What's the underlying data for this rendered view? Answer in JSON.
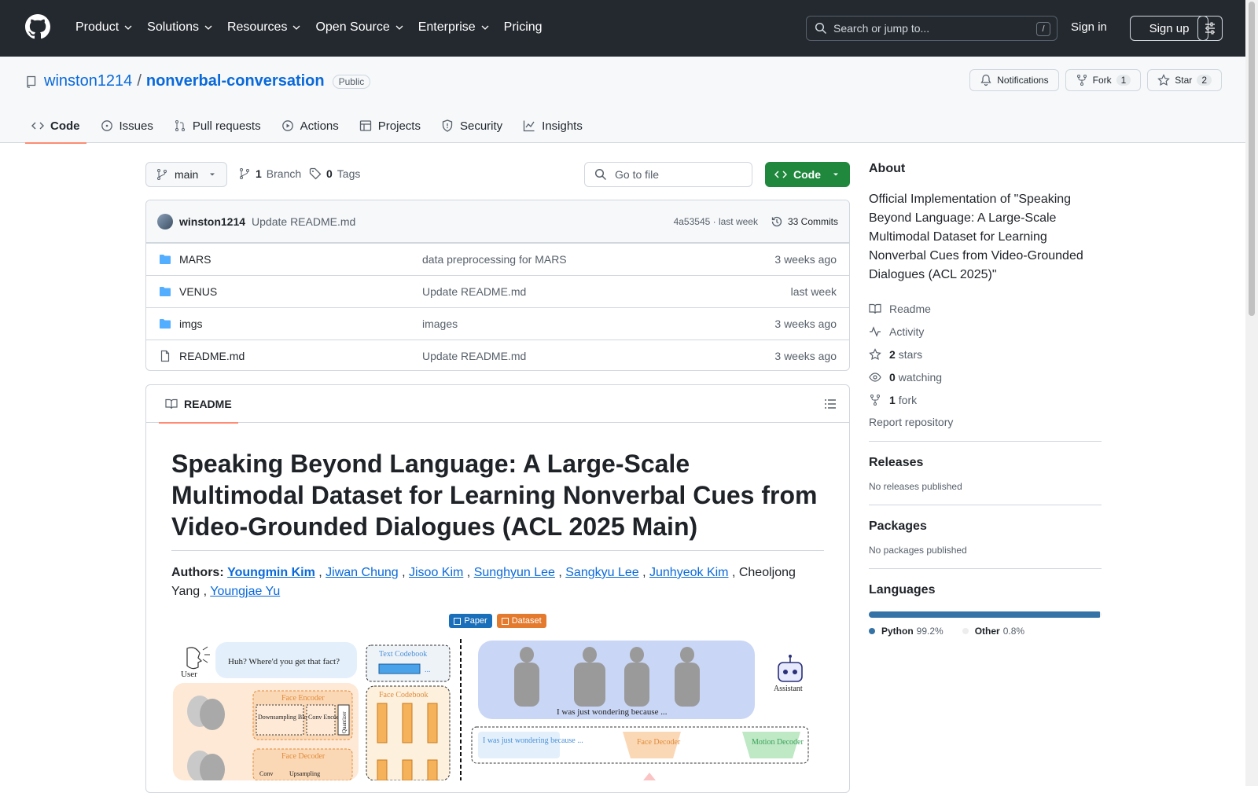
{
  "topnav": {
    "items": [
      {
        "label": "Product",
        "dropdown": true
      },
      {
        "label": "Solutions",
        "dropdown": true
      },
      {
        "label": "Resources",
        "dropdown": true
      },
      {
        "label": "Open Source",
        "dropdown": true
      },
      {
        "label": "Enterprise",
        "dropdown": true
      },
      {
        "label": "Pricing",
        "dropdown": false
      }
    ],
    "search_placeholder": "Search or jump to...",
    "search_shortcut": "/",
    "signin": "Sign in",
    "signup": "Sign up"
  },
  "repo": {
    "owner": "winston1214",
    "separator": "/",
    "name": "nonverbal-conversation",
    "visibility": "Public",
    "notifications_label": "Notifications",
    "fork_label": "Fork",
    "fork_count": "1",
    "star_label": "Star",
    "star_count": "2"
  },
  "tabs": [
    {
      "label": "Code",
      "icon": "code-icon",
      "active": true
    },
    {
      "label": "Issues",
      "icon": "issue-icon",
      "active": false
    },
    {
      "label": "Pull requests",
      "icon": "pull-request-icon",
      "active": false
    },
    {
      "label": "Actions",
      "icon": "play-icon",
      "active": false
    },
    {
      "label": "Projects",
      "icon": "table-icon",
      "active": false
    },
    {
      "label": "Security",
      "icon": "shield-icon",
      "active": false
    },
    {
      "label": "Insights",
      "icon": "graph-icon",
      "active": false
    }
  ],
  "branch": {
    "name": "main",
    "branch_count": "1",
    "branch_label": "Branch",
    "tag_count": "0",
    "tag_label": "Tags",
    "goto_placeholder": "Go to file",
    "code_button": "Code"
  },
  "commit": {
    "user": "winston1214",
    "message": "Update README.md",
    "hash_time": "4a53545 · last week",
    "commits_label": "33 Commits"
  },
  "files": [
    {
      "name": "MARS",
      "type": "folder",
      "message": "data preprocessing for MARS",
      "time": "3 weeks ago"
    },
    {
      "name": "VENUS",
      "type": "folder",
      "message": "Update README.md",
      "time": "last week"
    },
    {
      "name": "imgs",
      "type": "folder",
      "message": "images",
      "time": "3 weeks ago"
    },
    {
      "name": "README.md",
      "type": "file",
      "message": "Update README.md",
      "time": "3 weeks ago"
    }
  ],
  "readme": {
    "tab_label": "README",
    "title": "Speaking Beyond Language: A Large-Scale Multimodal Dataset for Learning Nonverbal Cues from Video-Grounded Dialogues (ACL 2025 Main)",
    "authors_label": "Authors:",
    "authors": [
      "Youngmin Kim",
      "Jiwan Chung",
      "Jisoo Kim",
      "Sunghyun Lee",
      "Sangkyu Lee",
      "Junhyeok Kim"
    ],
    "authors_plain": "Cheoljong Yang",
    "authors_last": "Youngjae Yu",
    "badge_paper": "Paper",
    "badge_dataset": "Dataset",
    "figure": {
      "user_label": "User",
      "user_speech": "Huh? Where'd you get that fact?",
      "text_codebook": "Text Codebook",
      "face_codebook": "Face Codebook",
      "face_encoder": "Face Encoder",
      "downsampling_block": "Downsampling Block",
      "conv_encoder": "Conv Encoder",
      "quantizer": "Quantizer",
      "face_decoder_left": "Face Decoder",
      "conv": "Conv",
      "upsampling": "Upsampling",
      "assistant_label": "Assistant",
      "assistant_speech": "I was just wondering because ...",
      "output_text": "I was just wondering because ...",
      "face_decoder": "Face Decoder",
      "motion_decoder": "Motion Decoder",
      "ellipsis": "..."
    }
  },
  "sidebar": {
    "about_heading": "About",
    "about_text": "Official Implementation of \"Speaking Beyond Language: A Large-Scale Multimodal Dataset for Learning Nonverbal Cues from Video-Grounded Dialogues (ACL 2025)\"",
    "readme": "Readme",
    "activity": "Activity",
    "stars_count": "2",
    "stars_label": "stars",
    "watching_count": "0",
    "watching_label": "watching",
    "fork_count": "1",
    "fork_label": "fork",
    "report": "Report repository",
    "releases_heading": "Releases",
    "releases_text": "No releases published",
    "packages_heading": "Packages",
    "packages_text": "No packages published",
    "languages_heading": "Languages",
    "languages": [
      {
        "name": "Python",
        "percent": "99.2%",
        "fraction": 0.992,
        "color": "#3572A5"
      },
      {
        "name": "Other",
        "percent": "0.8%",
        "fraction": 0.008,
        "color": "#ededed"
      }
    ]
  }
}
